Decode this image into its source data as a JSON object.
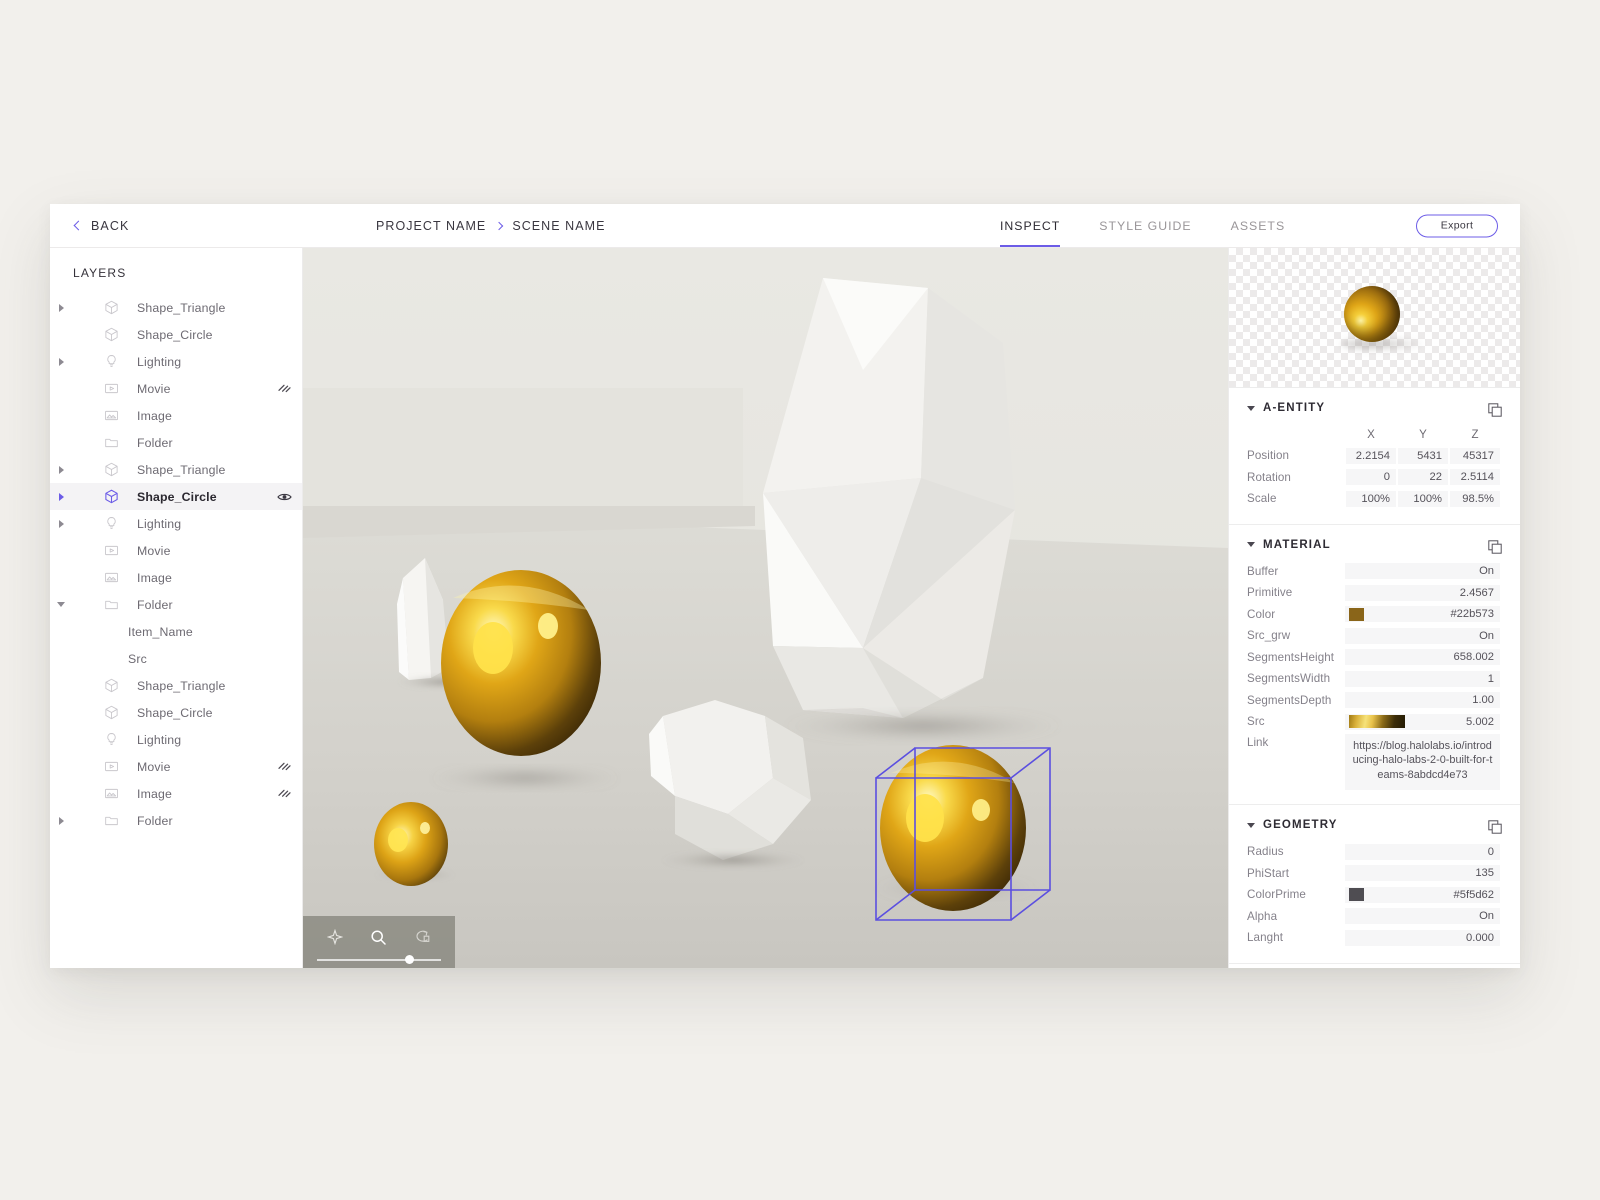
{
  "topbar": {
    "back_label": "BACK",
    "breadcrumb": {
      "project": "PROJECT NAME",
      "scene": "SCENE NAME"
    },
    "tabs": [
      {
        "label": "INSPECT",
        "active": true
      },
      {
        "label": "STYLE GUIDE",
        "active": false
      },
      {
        "label": "ASSETS",
        "active": false
      }
    ],
    "export_label": "Export",
    "accent_color": "#6c5ce7"
  },
  "layers": {
    "title": "LAYERS",
    "items": [
      {
        "label": "Shape_Triangle",
        "icon": "cube-icon",
        "disclosure": "closed",
        "indent": 0,
        "selected": false,
        "right_icon": "none"
      },
      {
        "label": "Shape_Circle",
        "icon": "cube-icon",
        "disclosure": "none",
        "indent": 0,
        "selected": false,
        "right_icon": "none"
      },
      {
        "label": "Lighting",
        "icon": "bulb-icon",
        "disclosure": "closed",
        "indent": 0,
        "selected": false,
        "right_icon": "none"
      },
      {
        "label": "Movie",
        "icon": "movie-icon",
        "disclosure": "none",
        "indent": 0,
        "selected": false,
        "right_icon": "hidden-icon"
      },
      {
        "label": "Image",
        "icon": "image-icon",
        "disclosure": "none",
        "indent": 0,
        "selected": false,
        "right_icon": "none"
      },
      {
        "label": "Folder",
        "icon": "folder-icon",
        "disclosure": "none",
        "indent": 0,
        "selected": false,
        "right_icon": "none"
      },
      {
        "label": "Shape_Triangle",
        "icon": "cube-icon",
        "disclosure": "closed",
        "indent": 0,
        "selected": false,
        "right_icon": "none"
      },
      {
        "label": "Shape_Circle",
        "icon": "cube-icon",
        "disclosure": "closed",
        "indent": 0,
        "selected": true,
        "right_icon": "eye-icon"
      },
      {
        "label": "Lighting",
        "icon": "bulb-icon",
        "disclosure": "closed",
        "indent": 0,
        "selected": false,
        "right_icon": "none"
      },
      {
        "label": "Movie",
        "icon": "movie-icon",
        "disclosure": "none",
        "indent": 0,
        "selected": false,
        "right_icon": "none"
      },
      {
        "label": "Image",
        "icon": "image-icon",
        "disclosure": "none",
        "indent": 0,
        "selected": false,
        "right_icon": "none"
      },
      {
        "label": "Folder",
        "icon": "folder-icon",
        "disclosure": "open",
        "indent": 0,
        "selected": false,
        "right_icon": "none"
      },
      {
        "label": "Item_Name",
        "icon": "none",
        "disclosure": "none",
        "indent": 1,
        "selected": false,
        "right_icon": "none"
      },
      {
        "label": "Src",
        "icon": "none",
        "disclosure": "none",
        "indent": 1,
        "selected": false,
        "right_icon": "none"
      },
      {
        "label": "Shape_Triangle",
        "icon": "cube-icon",
        "disclosure": "none",
        "indent": 0,
        "selected": false,
        "right_icon": "none"
      },
      {
        "label": "Shape_Circle",
        "icon": "cube-icon",
        "disclosure": "none",
        "indent": 0,
        "selected": false,
        "right_icon": "none"
      },
      {
        "label": "Lighting",
        "icon": "bulb-icon",
        "disclosure": "none",
        "indent": 0,
        "selected": false,
        "right_icon": "none"
      },
      {
        "label": "Movie",
        "icon": "movie-icon",
        "disclosure": "none",
        "indent": 0,
        "selected": false,
        "right_icon": "hidden-icon"
      },
      {
        "label": "Image",
        "icon": "image-icon",
        "disclosure": "none",
        "indent": 0,
        "selected": false,
        "right_icon": "hidden-icon"
      },
      {
        "label": "Folder",
        "icon": "folder-icon",
        "disclosure": "closed",
        "indent": 0,
        "selected": false,
        "right_icon": "none"
      }
    ]
  },
  "viewport": {
    "toolbar_icons": [
      "move-icon",
      "search-icon",
      "orbit-icon"
    ],
    "slider_value": 71,
    "selection_box_color": "#5b4fe0"
  },
  "inspector": {
    "thumbnail": {
      "name": "sphere-thumbnail"
    },
    "sections": [
      {
        "title": "A-ENTITY",
        "expanded": true,
        "axis_headers": [
          "X",
          "Y",
          "Z"
        ],
        "rows": [
          {
            "label": "Position",
            "values": [
              "2.2154",
              "5431",
              "45317"
            ]
          },
          {
            "label": "Rotation",
            "values": [
              "0",
              "22",
              "2.5114"
            ]
          },
          {
            "label": "Scale",
            "values": [
              "100%",
              "100%",
              "98.5%"
            ]
          }
        ]
      },
      {
        "title": "MATERIAL",
        "expanded": true,
        "rows": [
          {
            "label": "Buffer",
            "value": "On"
          },
          {
            "label": "Primitive",
            "value": "2.4567"
          },
          {
            "label": "Color",
            "value": "#22b573",
            "swatch": "#8a6519"
          },
          {
            "label": "Src_grw",
            "value": "On"
          },
          {
            "label": "SegmentsHeight",
            "value": "658.002"
          },
          {
            "label": "SegmentsWidth",
            "value": "1"
          },
          {
            "label": "SegmentsDepth",
            "value": "1.00"
          },
          {
            "label": "Src",
            "value": "5.002",
            "gradient": true
          }
        ],
        "link": {
          "label": "Link",
          "value": "https://blog.halolabs.io/introducing-halo-labs-2-0-built-for-teams-8abdcd4e73"
        }
      },
      {
        "title": "GEOMETRY",
        "expanded": true,
        "rows": [
          {
            "label": "Radius",
            "value": "0"
          },
          {
            "label": "PhiStart",
            "value": "135"
          },
          {
            "label": "ColorPrime",
            "value": "#5f5d62",
            "swatch": "#4f4d52"
          },
          {
            "label": "Alpha",
            "value": "On"
          },
          {
            "label": "Langht",
            "value": "0.000"
          }
        ]
      }
    ]
  }
}
